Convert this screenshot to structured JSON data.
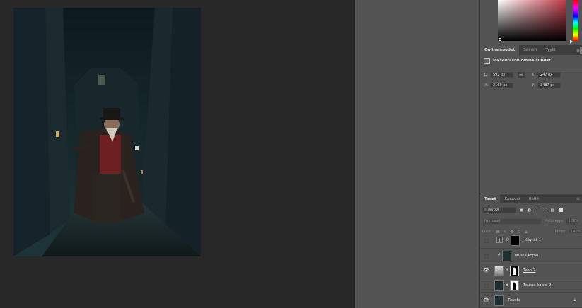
{
  "properties_panel": {
    "tabs": [
      {
        "label": "Ominaisuudet",
        "active": true
      },
      {
        "label": "Säädöt",
        "active": false
      },
      {
        "label": "Tyylit",
        "active": false
      }
    ],
    "header": "Pikselitason ominaisuudet",
    "fields": {
      "w_label": "L:",
      "w_value": "592 px",
      "h_label": "K:",
      "h_value": "247 px",
      "x_label": "X:",
      "x_value": "2169 px",
      "y_label": "Y:",
      "y_value": "3487 px"
    }
  },
  "layers_panel": {
    "tabs": [
      {
        "label": "Tasot",
        "active": true
      },
      {
        "label": "Kanavat",
        "active": false
      },
      {
        "label": "Reitit",
        "active": false
      }
    ],
    "filter_value": "Tyyppi",
    "blend_mode": "Normaali",
    "opacity_label": "Peittävyys:",
    "opacity_value": "100%",
    "lock_label": "Lukit.:",
    "fill_label": "Täyttö:",
    "fill_value": "100%",
    "layers": [
      {
        "name": "Käyrät 1",
        "visible": false,
        "type": "adjustment",
        "underline": true
      },
      {
        "name": "Tausta kopio",
        "visible": false,
        "type": "clipped"
      },
      {
        "name": "Taso 2",
        "visible": true,
        "type": "masked",
        "underline": true
      },
      {
        "name": "Tausta kopio 2",
        "visible": false,
        "type": "masked"
      },
      {
        "name": "Tausta",
        "visible": true,
        "type": "background",
        "italic": true,
        "locked": true
      }
    ]
  },
  "colors": {
    "panel_bg": "#535353",
    "canvas_bg": "#282828",
    "tab_bar_bg": "#3e3e3e"
  },
  "icons": [
    "link-icon",
    "eye-icon",
    "lock-icon",
    "chain-icon",
    "filter-image-icon",
    "adjustment-icon",
    "text-icon"
  ]
}
